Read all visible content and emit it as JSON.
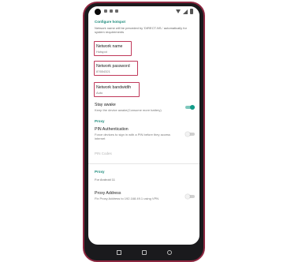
{
  "configure": {
    "section_label": "Configure hotspot",
    "description": "Network name will be preceded by 'DIRECT-NS-' automatically for system requirements"
  },
  "network_name": {
    "label": "Network name",
    "value": "Hotspot"
  },
  "network_password": {
    "label": "Network password",
    "value": "87654321"
  },
  "network_bandwidth": {
    "label": "Network bandwidth",
    "value": "Auto"
  },
  "stay_awake": {
    "label": "Stay awake",
    "description": "Keep the device awake(Consume more battery)",
    "enabled": true
  },
  "proxy_section_1": {
    "label": "Proxy"
  },
  "pin_auth": {
    "label": "PIN Authentication",
    "description": "Force devices to sign in with a PIN before they access internet",
    "enabled": false
  },
  "pin_codes": {
    "label": "PIN Codes"
  },
  "proxy_section_2": {
    "label": "Proxy",
    "note": "For Android 11"
  },
  "proxy_address": {
    "label": "Proxy Address",
    "description": "Fix Proxy Address to 192.168.49.1 using VPN",
    "enabled": false
  },
  "colors": {
    "accent": "#129c89",
    "highlight": "#c0395a",
    "phone_frame": "#8d2740"
  }
}
